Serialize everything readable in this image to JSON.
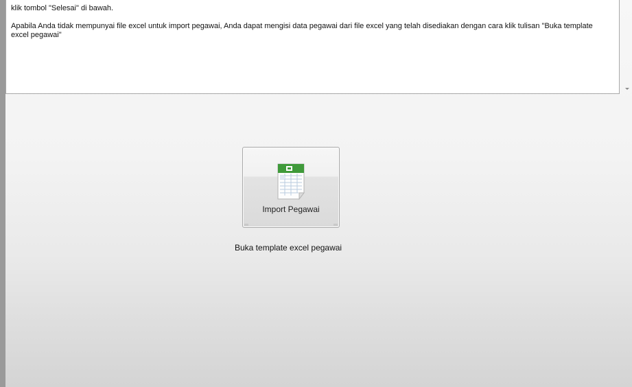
{
  "info_panel": {
    "line_1": "klik tombol \"Selesai\" di bawah.",
    "paragraph_2": "Apabila Anda tidak mempunyai file excel untuk import pegawai, Anda dapat mengisi data pegawai dari file excel yang telah disediakan dengan cara klik tulisan \"Buka template excel pegawai\""
  },
  "import_button": {
    "label": "Import Pegawai",
    "icon": "excel-spreadsheet-icon",
    "icon_colors": {
      "header_green": "#3f9a3a",
      "sheet": "#ffffff",
      "grid": "#b9cbe0"
    }
  },
  "template_link": {
    "text": "Buka template excel pegawai"
  },
  "colors": {
    "panel_border": "#a8a8a8",
    "background_top": "#f7f7f7",
    "background_bottom": "#d4d4d4"
  }
}
